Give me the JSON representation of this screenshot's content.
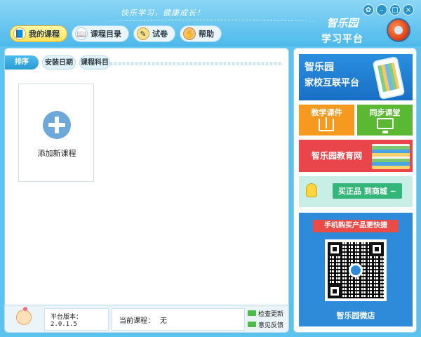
{
  "header": {
    "slogan": "快乐学习，健康成长！",
    "brand_line1": "智乐园",
    "brand_line2": "学习平台",
    "nav": [
      {
        "label": "我的课程",
        "icon": "book-icon"
      },
      {
        "label": "课程目录",
        "icon": "catalog-icon"
      },
      {
        "label": "试卷",
        "icon": "paper-icon"
      },
      {
        "label": "帮助",
        "icon": "help-icon"
      }
    ],
    "window_controls": {
      "settings": "✿",
      "minimize": "–",
      "maximize": "□",
      "close": "×"
    }
  },
  "main": {
    "tabs": {
      "sort": "排序",
      "install_date": "安装日期",
      "subject": "课程科目"
    },
    "add_course_label": "添加新课程"
  },
  "status": {
    "version": "平台版本：2.0.1.5",
    "current_course_label": "当前课程：",
    "current_course_value": "无",
    "check_update": "检查更新",
    "feedback": "意见反馈"
  },
  "ads": {
    "home_school_title": "智乐园",
    "home_school_subtitle": "家校互联平台",
    "teaching_course": "教学课件",
    "sync_class": "同步课堂",
    "edu_network": "智乐园教育网",
    "shop": "买正品 到商城 ~",
    "mobile_banner": "手机购买产品更快捷",
    "wechat_store": "智乐园微店"
  },
  "colors": {
    "accent": "#4db9ea",
    "orange": "#f59a1e",
    "green": "#5bb833",
    "red": "#e9454a",
    "blue": "#2d8bd9"
  }
}
